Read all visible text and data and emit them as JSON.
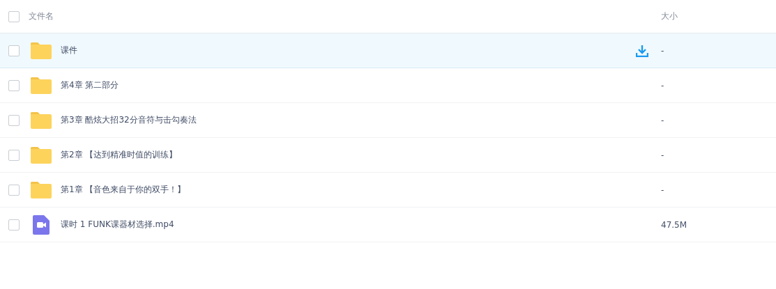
{
  "header": {
    "checked": false,
    "name_column": "文件名",
    "size_column": "大小"
  },
  "rows": [
    {
      "kind": "folder",
      "name": "课件",
      "size": "-",
      "checked": false,
      "highlighted": true
    },
    {
      "kind": "folder",
      "name": "第4章 第二部分",
      "size": "-",
      "checked": false,
      "highlighted": false
    },
    {
      "kind": "folder",
      "name": "第3章 酷炫大招32分音符与击勾奏法",
      "size": "-",
      "checked": false,
      "highlighted": false
    },
    {
      "kind": "folder",
      "name": "第2章 【达到精准时值的训练】",
      "size": "-",
      "checked": false,
      "highlighted": false
    },
    {
      "kind": "folder",
      "name": "第1章 【音色来自于你的双手！】",
      "size": "-",
      "checked": false,
      "highlighted": false
    },
    {
      "kind": "video",
      "name": "课时 1 FUNK课器材选择.mp4",
      "size": "47.5M",
      "checked": false,
      "highlighted": false
    }
  ]
}
